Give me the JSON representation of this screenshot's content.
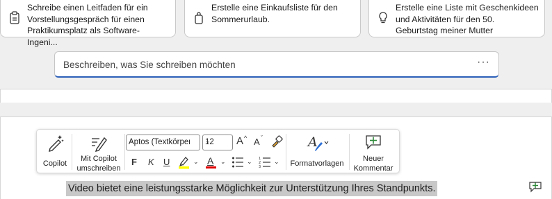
{
  "suggestions": [
    {
      "text": "Schreibe einen Leitfaden für ein\nVorstellungsgespräch für einen\nPraktikumsplatz als Software-Ingeni...",
      "icon": "clipboard-icon"
    },
    {
      "text": "Erstelle eine Einkaufsliste für den\nSommerurlaub.",
      "icon": "shopping-bag-icon"
    },
    {
      "text": "Erstelle eine Liste mit Geschenkideen\nund Aktivitäten für den 50.\nGeburtstag meiner Mutter",
      "icon": "lightbulb-icon"
    }
  ],
  "prompt": {
    "placeholder": "Beschreiben, was Sie schreiben möchten",
    "more": "···"
  },
  "toolbar": {
    "copilot_label": "Copilot",
    "rewrite_label": "Mit Copilot\numschreiben",
    "font_name": "Aptos (Textkörper)",
    "font_size": "12",
    "grow_font": "A",
    "shrink_font": "A",
    "bold": "F",
    "italic": "K",
    "underline": "U",
    "font_color_letter": "A",
    "styles_label": "Formatvorlagen",
    "new_comment_label": "Neuer\nKommentar"
  },
  "document": {
    "selected_text": "Video bietet eine leistungsstarke Möglichkeit zur Unterstützung Ihres Standpunkts."
  },
  "colors": {
    "accent": "#2b5fb8",
    "highlight": "#ffff00",
    "font_color": "#e00000",
    "comment_green": "#2e8b3a"
  }
}
